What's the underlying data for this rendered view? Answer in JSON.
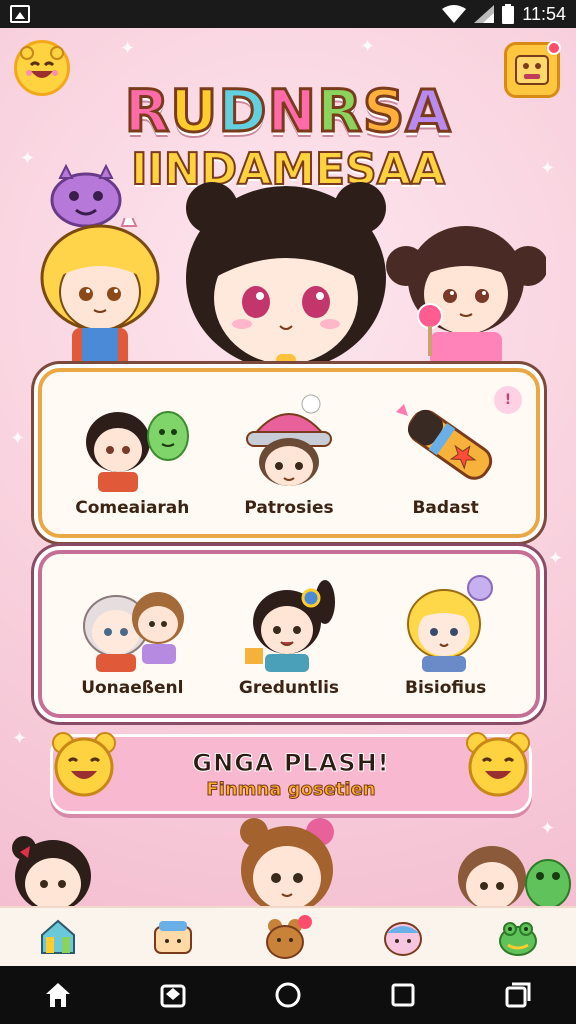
{
  "status_bar": {
    "time": "11:54",
    "left_icon": "image-notification-icon",
    "right_icons": [
      "wifi-icon",
      "signal-icon",
      "battery-icon"
    ]
  },
  "header": {
    "title_line1": "RUDNRSA",
    "title_line2": "IINDAMESAA",
    "left_button_icon": "smiley-face-icon",
    "right_button_icon": "menu-face-icon"
  },
  "grid_top": {
    "items": [
      {
        "label": "Comeaiarah",
        "icon": "chibi-with-green-monster"
      },
      {
        "label": "Patrosies",
        "icon": "chibi-with-beanie"
      },
      {
        "label": "Badast",
        "icon": "crayon-star-item"
      }
    ],
    "info_badge": "!"
  },
  "grid_bottom": {
    "items": [
      {
        "label": "Uonaeßenl",
        "icon": "two-chibis"
      },
      {
        "label": "Greduntlis",
        "icon": "chibi-with-flower"
      },
      {
        "label": "Bisiofius",
        "icon": "blonde-chibi"
      }
    ]
  },
  "promo": {
    "title": "GNGA PLASH!",
    "subtitle": "Finmna gosetien"
  },
  "tabbar": {
    "tabs": [
      "home-tab-icon",
      "folder-tab-icon",
      "bear-tab-icon",
      "face-tab-icon",
      "frog-tab-icon"
    ]
  },
  "nav_bar": {
    "buttons": [
      "home-nav-icon",
      "app-nav-icon",
      "circle-nav-icon",
      "square-nav-icon",
      "recents-nav-icon"
    ]
  },
  "colors": {
    "background": "#f9d3de",
    "panel_top_border": "#e9a844",
    "panel_bottom_border": "#c56e96",
    "accent_yellow": "#ffd23f",
    "accent_pink": "#ff6aa8"
  }
}
